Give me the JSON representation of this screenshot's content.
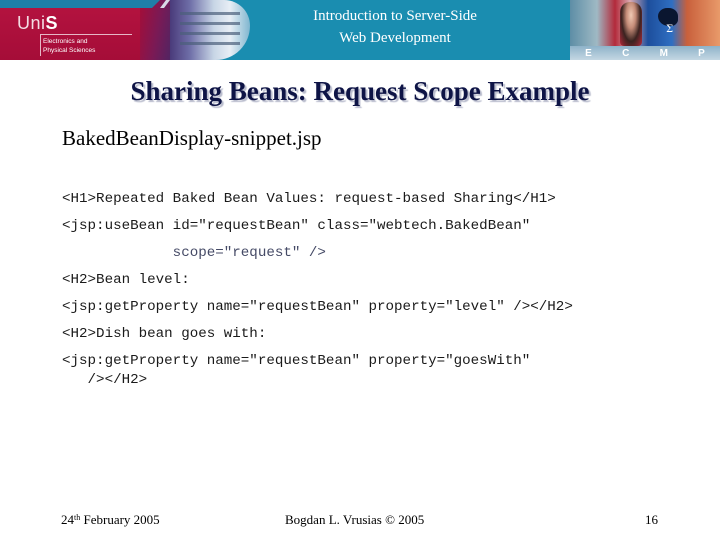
{
  "header": {
    "logo_prefix": "Uni",
    "logo_suffix": "S",
    "department_line1": "Electronics and",
    "department_line2": "Physical Sciences",
    "course_line1": "Introduction to Server-Side",
    "course_line2": "Web Development",
    "collage_letters": [
      "E",
      "C",
      "M",
      "P"
    ],
    "colors": {
      "banner_teal": "#1a8db0",
      "banner_red": "#a50d38"
    }
  },
  "slide": {
    "title": "Sharing Beans: Request Scope Example",
    "title_color": "#0e1446",
    "file_name": "BakedBeanDisplay-snippet.jsp",
    "code_lines": [
      "<H1>Repeated Baked Bean Values: request-based Sharing</H1>",
      "<jsp:useBean id=\"requestBean\" class=\"webtech.BakedBean\"",
      "             scope=\"request\" />",
      "<H2>Bean level:",
      "<jsp:getProperty name=\"requestBean\" property=\"level\" /></H2>",
      "<H2>Dish bean goes with:",
      "<jsp:getProperty name=\"requestBean\" property=\"goesWith\"",
      "   /></H2>"
    ]
  },
  "footer": {
    "date_day": "24",
    "date_suffix": "th",
    "date_rest": " February 2005",
    "author": "Bogdan L. Vrusias © 2005",
    "page_number": "16"
  }
}
